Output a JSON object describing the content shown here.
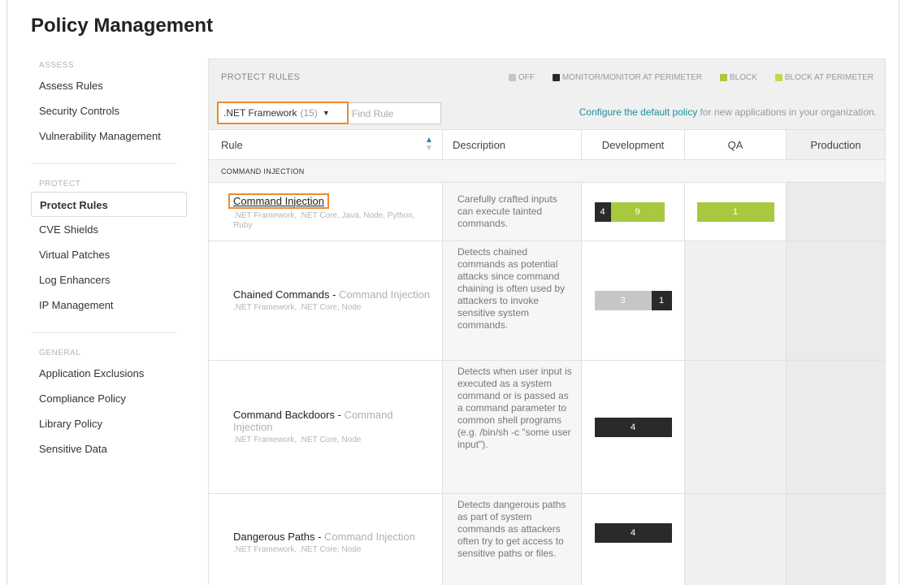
{
  "page": {
    "title": "Policy Management"
  },
  "sidebar": {
    "sections": [
      {
        "label": "ASSESS",
        "items": [
          "Assess Rules",
          "Security Controls",
          "Vulnerability Management"
        ]
      },
      {
        "label": "PROTECT",
        "items": [
          "Protect Rules",
          "CVE Shields",
          "Virtual Patches",
          "Log Enhancers",
          "IP Management"
        ]
      },
      {
        "label": "GENERAL",
        "items": [
          "Application Exclusions",
          "Compliance Policy",
          "Library Policy",
          "Sensitive Data"
        ]
      }
    ],
    "active_item": "Protect Rules"
  },
  "panel": {
    "title": "PROTECT RULES",
    "legend": [
      {
        "label": "OFF",
        "color": "#c6c6c6"
      },
      {
        "label": "MONITOR/MONITOR AT PERIMETER",
        "color": "#2a2a2a"
      },
      {
        "label": "BLOCK",
        "color": "#a8c93f"
      },
      {
        "label": "BLOCK AT PERIMETER",
        "color": "#c8d944"
      }
    ],
    "filter": {
      "framework_label": ".NET Framework",
      "framework_count": "(15)",
      "find_placeholder": "Find Rule"
    },
    "configure": {
      "link_text": "Configure the default policy",
      "rest_text": " for new applications in your organization."
    }
  },
  "table": {
    "columns": [
      "Rule",
      "Description",
      "Development",
      "QA",
      "Production"
    ],
    "group_label": "COMMAND INJECTION",
    "rows": [
      {
        "name": "Command Injection",
        "parent": "",
        "frameworks": ".NET Framework, .NET Core, Java, Node, Python, Ruby",
        "description": "Carefully crafted inputs can execute tainted commands.",
        "development": [
          {
            "mode": "monitor",
            "count": "4"
          },
          {
            "mode": "block",
            "count": "9"
          }
        ],
        "qa": [
          {
            "mode": "block",
            "count": "1"
          }
        ]
      },
      {
        "name": "Chained Commands - ",
        "parent": "Command Injection",
        "frameworks": ".NET Framework, .NET Core, Node",
        "description": "Detects chained commands as potential attacks since command chaining is often used by attackers to invoke sensitive system commands.",
        "development": [
          {
            "mode": "off",
            "count": "3"
          },
          {
            "mode": "monitor",
            "count": "1"
          }
        ],
        "qa": []
      },
      {
        "name": "Command Backdoors - ",
        "parent": "Command Injection",
        "frameworks": ".NET Framework, .NET Core, Node",
        "description": "Detects when user input is executed as a system command or is passed as a command parameter to common shell programs (e.g. /bin/sh -c \"some user input\").",
        "development": [
          {
            "mode": "monitor",
            "count": "4"
          }
        ],
        "qa": []
      },
      {
        "name": "Dangerous Paths - ",
        "parent": "Command Injection",
        "frameworks": ".NET Framework, .NET Core, Node",
        "description": "Detects dangerous paths as part of system commands as attackers often try to get access to sensitive paths or files.",
        "development": [
          {
            "mode": "monitor",
            "count": "4"
          }
        ],
        "qa": []
      }
    ]
  }
}
